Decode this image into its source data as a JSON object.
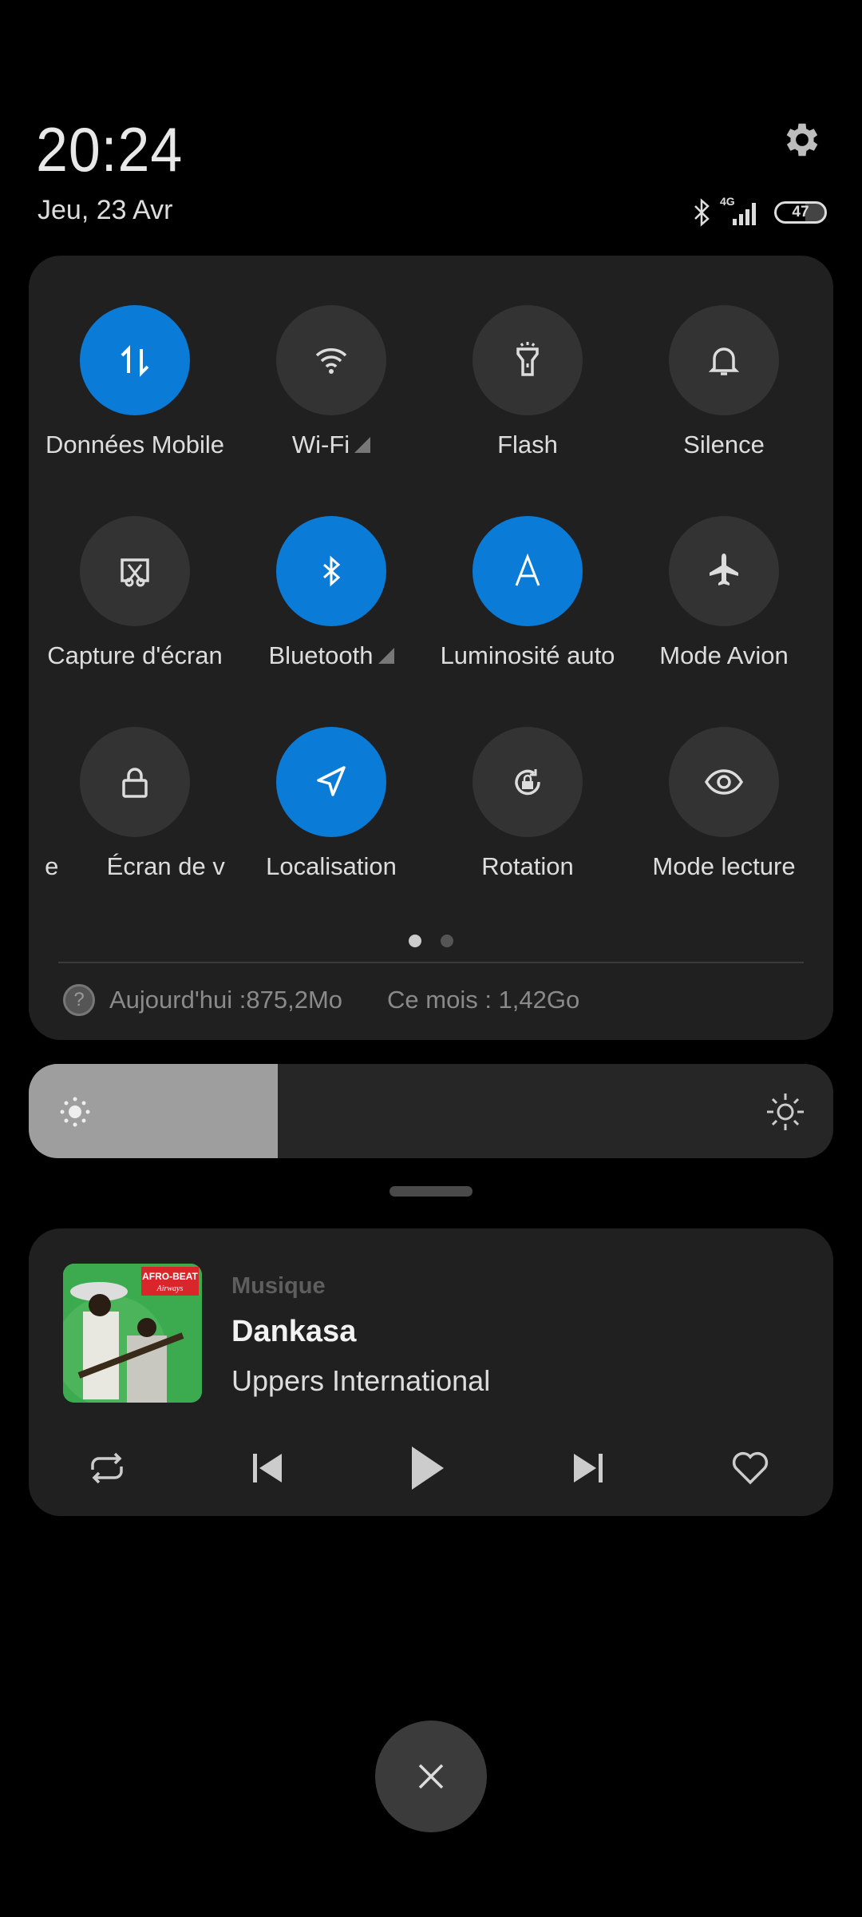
{
  "header": {
    "time": "20:24",
    "date": "Jeu, 23 Avr",
    "network_type": "4G",
    "battery": "47"
  },
  "colors": {
    "accent": "#0a7bd6",
    "panel": "#202020",
    "tile_off": "#333333"
  },
  "tiles": [
    {
      "label": "Données Mobile",
      "icon": "mobile-data-icon",
      "active": true
    },
    {
      "label": "Wi-Fi",
      "icon": "wifi-icon",
      "active": false,
      "expandable": true
    },
    {
      "label": "Flash",
      "icon": "flashlight-icon",
      "active": false
    },
    {
      "label": "Silence",
      "icon": "bell-icon",
      "active": false
    },
    {
      "label": "Capture d'écran",
      "icon": "screenshot-icon",
      "active": false
    },
    {
      "label": "Bluetooth",
      "icon": "bluetooth-icon",
      "active": true,
      "expandable": true
    },
    {
      "label": "Luminosité auto",
      "icon": "auto-brightness-icon",
      "active": true
    },
    {
      "label": "Mode Avion",
      "icon": "airplane-icon",
      "active": false
    },
    {
      "label": "e       Écran de v",
      "icon": "lock-icon",
      "active": false
    },
    {
      "label": "Localisation",
      "icon": "location-icon",
      "active": true
    },
    {
      "label": "Rotation",
      "icon": "rotation-lock-icon",
      "active": false
    },
    {
      "label": "Mode lecture",
      "icon": "eye-icon",
      "active": false
    }
  ],
  "pager": {
    "pages": 2,
    "current": 1
  },
  "usage": {
    "today": "Aujourd'hui :875,2Mo",
    "month": "Ce mois : 1,42Go"
  },
  "brightness": {
    "level_percent": 31
  },
  "media": {
    "app": "Musique",
    "title": "Dankasa",
    "artist": "Uppers International",
    "art_text": "AFRO-BEAT Airways"
  }
}
